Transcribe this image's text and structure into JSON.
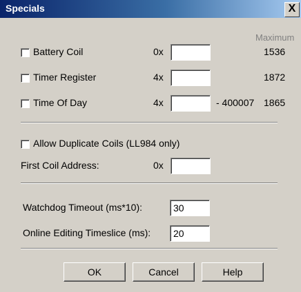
{
  "window": {
    "title": "Specials",
    "close_glyph": "X"
  },
  "specials": {
    "maximum_header": "Maximum",
    "rows": [
      {
        "label": "Battery Coil",
        "prefix": "0x",
        "value": "",
        "suffix": "",
        "maximum": "1536"
      },
      {
        "label": "Timer Register",
        "prefix": "4x",
        "value": "",
        "suffix": "",
        "maximum": "1872"
      },
      {
        "label": "Time Of Day",
        "prefix": "4x",
        "value": "",
        "suffix": "- 400007",
        "maximum": "1865"
      }
    ]
  },
  "coils": {
    "allow_duplicate_label": "Allow Duplicate Coils (LL984 only)",
    "first_coil_label": "First Coil Address:",
    "first_coil_prefix": "0x",
    "first_coil_value": ""
  },
  "timing": {
    "watchdog_label": "Watchdog Timeout (ms*10):",
    "watchdog_value": "30",
    "timeslice_label": "Online Editing Timeslice (ms):",
    "timeslice_value": "20"
  },
  "buttons": {
    "ok": "OK",
    "cancel": "Cancel",
    "help": "Help"
  }
}
